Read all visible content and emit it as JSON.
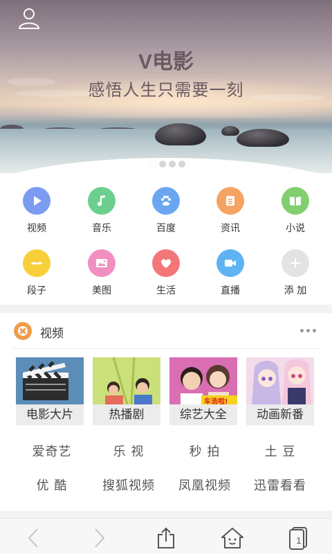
{
  "banner": {
    "title": "V电影",
    "subtitle": "感悟人生只需要一刻",
    "dots": 4,
    "active_dot": 0
  },
  "grid": [
    {
      "label": "视频",
      "icon": "play-icon",
      "color": "#7b9cf2"
    },
    {
      "label": "音乐",
      "icon": "music-note-icon",
      "color": "#6ccf8e"
    },
    {
      "label": "百度",
      "icon": "paw-icon",
      "color": "#6aa6f2"
    },
    {
      "label": "资讯",
      "icon": "news-icon",
      "color": "#f5a363"
    },
    {
      "label": "小说",
      "icon": "book-icon",
      "color": "#82cf70"
    },
    {
      "label": "段子",
      "icon": "mustache-icon",
      "color": "#f7cf3a"
    },
    {
      "label": "美图",
      "icon": "picture-icon",
      "color": "#f28fc1"
    },
    {
      "label": "生活",
      "icon": "heart-icon",
      "color": "#f37779"
    },
    {
      "label": "直播",
      "icon": "video-camera-icon",
      "color": "#5fb3f2"
    },
    {
      "label": "添 加",
      "icon": "plus-icon",
      "color": "#e3e3e3"
    }
  ],
  "video_card": {
    "title": "视频",
    "thumbnails": [
      {
        "caption": "电影大片"
      },
      {
        "caption": "热播剧"
      },
      {
        "caption": "综艺大全",
        "sticker": "车浩啦!"
      },
      {
        "caption": "动画新番"
      }
    ],
    "links": [
      [
        "爱奇艺",
        "乐 视",
        "秒 拍",
        "土 豆"
      ],
      [
        "优 酷",
        "搜狐视频",
        "凤凰视频",
        "迅雷看看"
      ]
    ]
  },
  "toolbar": {
    "tab_count": "1"
  },
  "colors": {
    "accent_orange": "#f29c4b",
    "text_dark": "#333333",
    "text_gray": "#555555"
  }
}
